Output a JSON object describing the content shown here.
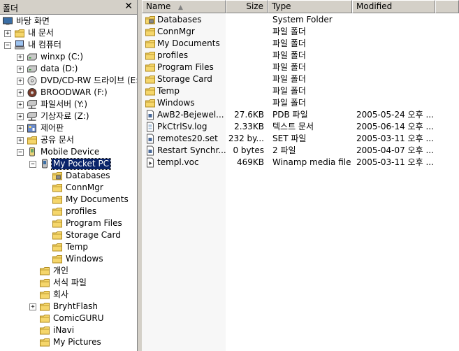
{
  "tree_pane": {
    "title": "폴더",
    "close_icon": "✕"
  },
  "tree_nodes": [
    {
      "label": "바탕 화면",
      "icon": "desktop-icon",
      "depth": 0,
      "exp": ""
    },
    {
      "label": "내 문서",
      "icon": "folder-icon",
      "depth": 1,
      "exp": "+"
    },
    {
      "label": "내 컴퓨터",
      "icon": "computer-icon",
      "depth": 1,
      "exp": "−"
    },
    {
      "label": "winxp (C:)",
      "icon": "drive-icon",
      "depth": 2,
      "exp": "+"
    },
    {
      "label": "data (D:)",
      "icon": "drive-icon",
      "depth": 2,
      "exp": "+"
    },
    {
      "label": "DVD/CD-RW 드라이브 (E:)",
      "icon": "cd-drive-icon",
      "depth": 2,
      "exp": "+"
    },
    {
      "label": "BROODWAR (F:)",
      "icon": "cd-app-icon",
      "depth": 2,
      "exp": "+"
    },
    {
      "label": "파일서버 (Y:)",
      "icon": "network-drive-icon",
      "depth": 2,
      "exp": "+"
    },
    {
      "label": "기상자료 (Z:)",
      "icon": "network-drive-icon",
      "depth": 2,
      "exp": "+"
    },
    {
      "label": "제어판",
      "icon": "control-panel-icon",
      "depth": 2,
      "exp": "+"
    },
    {
      "label": "공유 문서",
      "icon": "folder-icon",
      "depth": 2,
      "exp": "+"
    },
    {
      "label": "Mobile Device",
      "icon": "mobile-device-icon",
      "depth": 2,
      "exp": "−"
    },
    {
      "label": "My Pocket PC",
      "icon": "pocket-pc-icon",
      "depth": 3,
      "exp": "−",
      "selected": true
    },
    {
      "label": "Databases",
      "icon": "database-folder-icon",
      "depth": 4,
      "exp": ""
    },
    {
      "label": "ConnMgr",
      "icon": "folder-icon",
      "depth": 4,
      "exp": ""
    },
    {
      "label": "My Documents",
      "icon": "folder-icon",
      "depth": 4,
      "exp": ""
    },
    {
      "label": "profiles",
      "icon": "folder-icon",
      "depth": 4,
      "exp": ""
    },
    {
      "label": "Program Files",
      "icon": "folder-icon",
      "depth": 4,
      "exp": ""
    },
    {
      "label": "Storage Card",
      "icon": "folder-icon",
      "depth": 4,
      "exp": ""
    },
    {
      "label": "Temp",
      "icon": "folder-icon",
      "depth": 4,
      "exp": ""
    },
    {
      "label": "Windows",
      "icon": "folder-icon",
      "depth": 4,
      "exp": ""
    },
    {
      "label": "개인",
      "icon": "folder-icon",
      "depth": 3,
      "exp": ""
    },
    {
      "label": "서식 파일",
      "icon": "folder-icon",
      "depth": 3,
      "exp": ""
    },
    {
      "label": "회사",
      "icon": "folder-icon",
      "depth": 3,
      "exp": ""
    },
    {
      "label": "BryhtFlash",
      "icon": "folder-icon",
      "depth": 3,
      "exp": "+"
    },
    {
      "label": "ComicGURU",
      "icon": "folder-icon",
      "depth": 3,
      "exp": ""
    },
    {
      "label": "iNavi",
      "icon": "folder-icon",
      "depth": 3,
      "exp": ""
    },
    {
      "label": "My Pictures",
      "icon": "folder-icon",
      "depth": 3,
      "exp": ""
    }
  ],
  "list_header": {
    "name": "Name",
    "size": "Size",
    "type": "Type",
    "modified": "Modified",
    "sort_arrow": "▲"
  },
  "list_rows": [
    {
      "name": "Databases",
      "size": "",
      "type": "System Folder",
      "modified": "",
      "icon": "database-folder-icon"
    },
    {
      "name": "ConnMgr",
      "size": "",
      "type": "파일 폴더",
      "modified": "",
      "icon": "folder-icon"
    },
    {
      "name": "My Documents",
      "size": "",
      "type": "파일 폴더",
      "modified": "",
      "icon": "folder-icon"
    },
    {
      "name": "profiles",
      "size": "",
      "type": "파일 폴더",
      "modified": "",
      "icon": "folder-icon"
    },
    {
      "name": "Program Files",
      "size": "",
      "type": "파일 폴더",
      "modified": "",
      "icon": "folder-icon"
    },
    {
      "name": "Storage Card",
      "size": "",
      "type": "파일 폴더",
      "modified": "",
      "icon": "folder-icon"
    },
    {
      "name": "Temp",
      "size": "",
      "type": "파일 폴더",
      "modified": "",
      "icon": "folder-icon"
    },
    {
      "name": "Windows",
      "size": "",
      "type": "파일 폴더",
      "modified": "",
      "icon": "folder-icon"
    },
    {
      "name": "AwB2-Bejewel...",
      "size": "27.6KB",
      "type": "PDB 파일",
      "modified": "2005-05-24  오후 ...",
      "icon": "file-icon"
    },
    {
      "name": "PkCtrlSv.log",
      "size": "2.33KB",
      "type": "텍스트 문서",
      "modified": "2005-06-14  오후 ...",
      "icon": "text-file-icon"
    },
    {
      "name": "remotes20.set",
      "size": "232 by...",
      "type": "SET 파일",
      "modified": "2005-03-11  오후 ...",
      "icon": "file-icon"
    },
    {
      "name": "Restart Synchr...",
      "size": "0 bytes",
      "type": "2 파일",
      "modified": "2005-04-07  오후 ...",
      "icon": "file-icon"
    },
    {
      "name": "templ.voc",
      "size": "469KB",
      "type": "Winamp media file",
      "modified": "2005-03-11  오후 ...",
      "icon": "media-file-icon"
    }
  ],
  "colors": {
    "folder": "#f5d66b",
    "folder_edge": "#b08a1e",
    "selection": "#0a246a",
    "face": "#d4d0c8"
  }
}
